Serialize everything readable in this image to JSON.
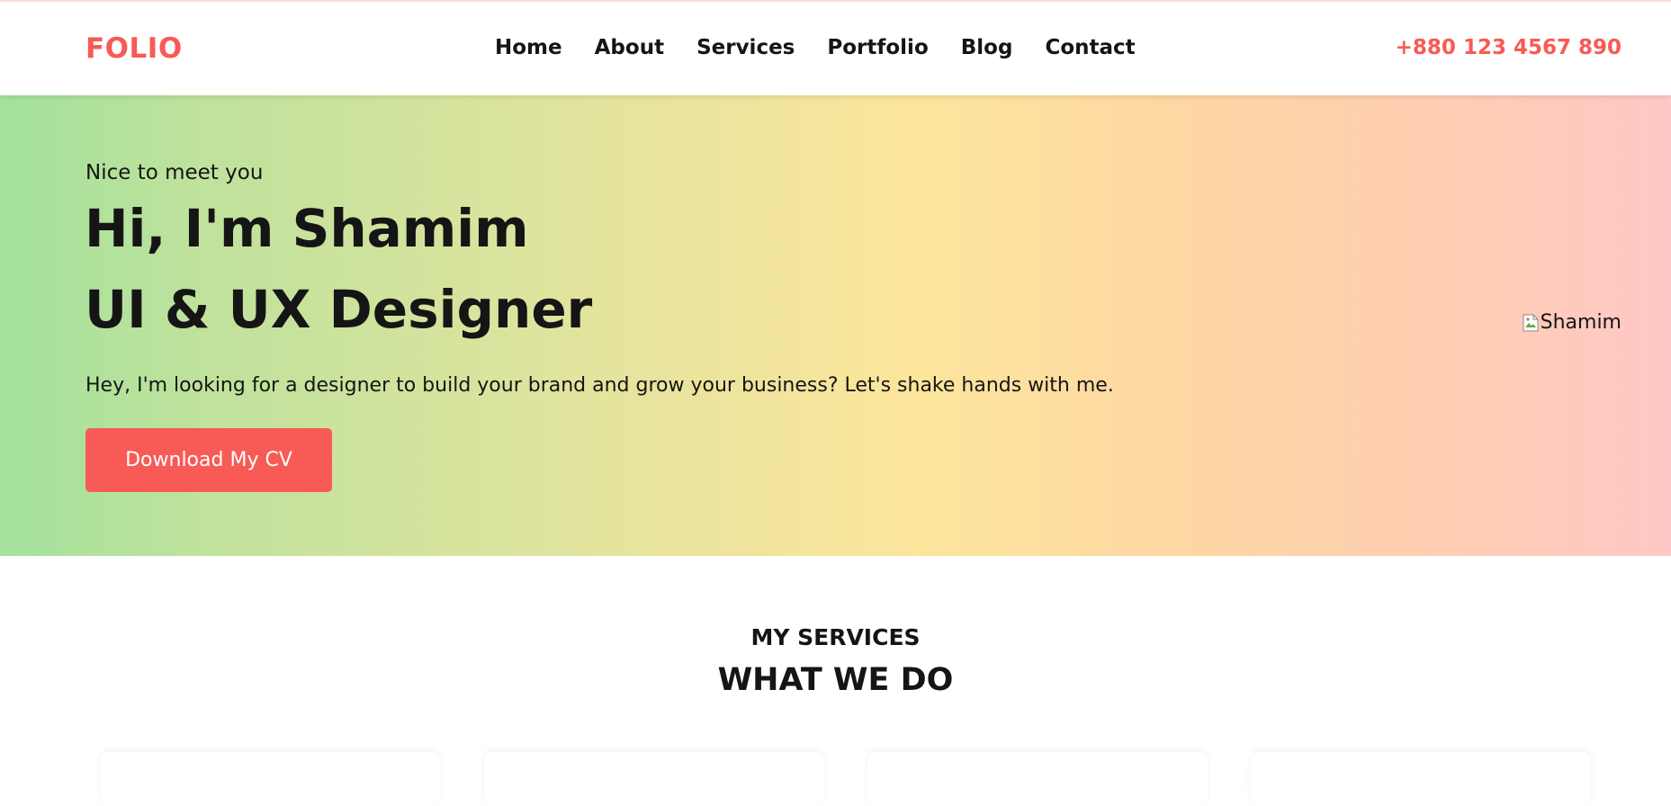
{
  "header": {
    "logo": "FOLIO",
    "nav": [
      "Home",
      "About",
      "Services",
      "Portfolio",
      "Blog",
      "Contact"
    ],
    "phone": "+880 123 4567 890"
  },
  "hero": {
    "eyebrow": "Nice to meet you",
    "heading_line1": "Hi, I'm Shamim",
    "heading_line2": "UI & UX Designer",
    "description": "Hey, I'm looking for a designer to build your brand and grow your business? Let's shake hands with me.",
    "cta_label": "Download My CV",
    "image_alt": "Shamim"
  },
  "services": {
    "kicker": "MY SERVICES",
    "title": "WHAT WE DO"
  },
  "colors": {
    "accent": "#f85a55",
    "text": "#151515",
    "hero_gradient_start": "#a3e29d",
    "hero_gradient_mid": "#fde59c",
    "hero_gradient_end": "#ffc8c6"
  },
  "icons": {
    "broken_image": "broken-image-icon"
  }
}
